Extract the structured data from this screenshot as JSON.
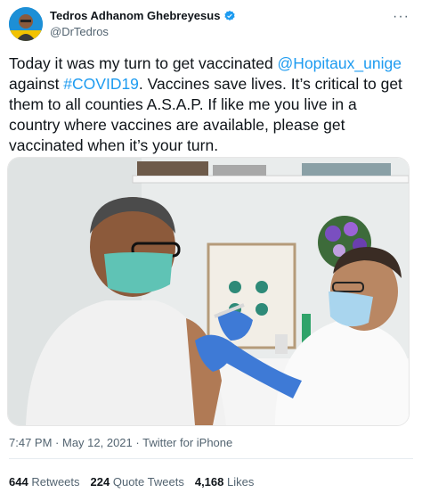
{
  "user": {
    "display_name": "Tedros Adhanom Ghebreyesus",
    "handle": "@DrTedros",
    "verified": true,
    "verified_icon": "verified-badge-icon",
    "more_icon": "more-options-icon"
  },
  "tweet": {
    "text_1": "Today it was my turn to get vaccinated",
    "mention": "@Hopitaux_unige",
    "text_2": " against ",
    "hashtag": "#COVID19",
    "text_3": ". Vaccines save lives. It’s critical to get them to all counties A.S.A.P. If like me you live in a country where vaccines are available, please get vaccinated when it’s your turn."
  },
  "meta": {
    "time": "7:47 PM",
    "sep1": " · ",
    "date": "May 12, 2021",
    "sep2": " · ",
    "source": "Twitter for iPhone"
  },
  "stats": {
    "retweets_count": "644",
    "retweets_label": "Retweets",
    "quotes_count": "224",
    "quotes_label": "Quote Tweets",
    "likes_count": "4,168",
    "likes_label": "Likes"
  },
  "colors": {
    "link": "#1d9bf0",
    "secondary_text": "#536471",
    "primary_text": "#0f1419"
  }
}
